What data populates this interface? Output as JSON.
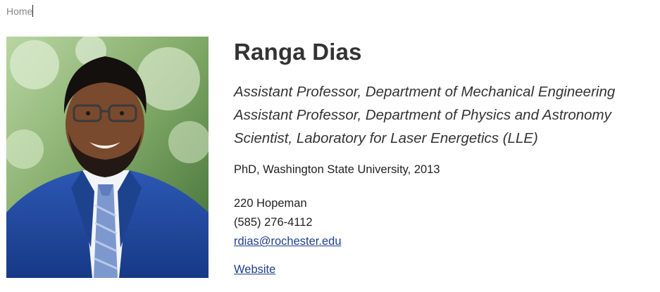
{
  "breadcrumb": {
    "home_label": "Home"
  },
  "profile": {
    "name": "Ranga Dias",
    "titles": [
      "Assistant Professor, Department of Mechanical Engineering",
      "Assistant Professor, Department of Physics and Astronomy",
      "Scientist, Laboratory for Laser Energetics (LLE)"
    ],
    "degree": "PhD, Washington State University, 2013",
    "office": "220 Hopeman",
    "phone": "(585) 276-4112",
    "email": "rdias@rochester.edu",
    "website_label": "Website"
  },
  "colors": {
    "link": "#1f3f8f",
    "heading": "#333333",
    "breadcrumb": "#888888"
  }
}
